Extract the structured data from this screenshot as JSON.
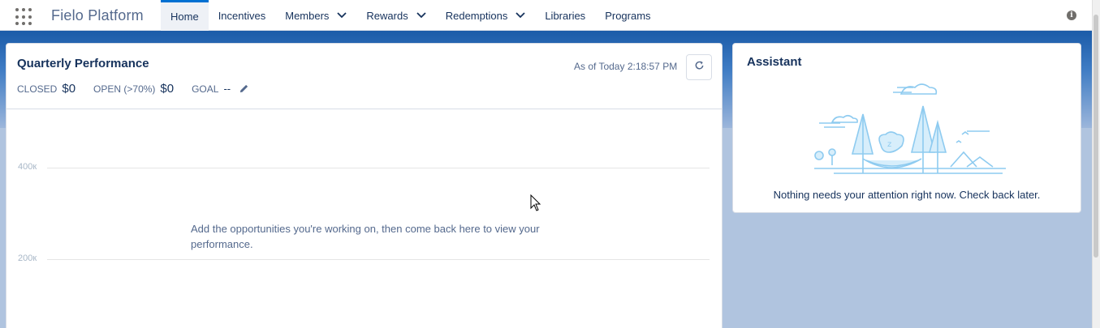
{
  "nav": {
    "app_name": "Fielo Platform",
    "items": [
      {
        "label": "Home",
        "active": true,
        "has_dropdown": false
      },
      {
        "label": "Incentives",
        "active": false,
        "has_dropdown": false
      },
      {
        "label": "Members",
        "active": false,
        "has_dropdown": true
      },
      {
        "label": "Rewards",
        "active": false,
        "has_dropdown": true
      },
      {
        "label": "Redemptions",
        "active": false,
        "has_dropdown": true
      },
      {
        "label": "Libraries",
        "active": false,
        "has_dropdown": false
      },
      {
        "label": "Programs",
        "active": false,
        "has_dropdown": false
      }
    ],
    "info_icon": "i"
  },
  "performance": {
    "title": "Quarterly Performance",
    "as_of": "As of Today 2:18:57 PM",
    "closed_label": "CLOSED",
    "closed_value": "$0",
    "open_label": "OPEN (>70%)",
    "open_value": "$0",
    "goal_label": "GOAL",
    "goal_value": "--",
    "empty_message": "Add the opportunities you're working on, then come back here to view your performance.",
    "ticks": [
      "400к",
      "200к"
    ]
  },
  "assistant": {
    "title": "Assistant",
    "message": "Nothing needs your attention right now. Check back later."
  },
  "colors": {
    "brand_blue": "#0070d2",
    "band_blue": "#1b5ba8",
    "illustration": "#8ecbf0"
  },
  "icons": [
    "app-launcher-icon",
    "chevron-down-icon",
    "info-icon",
    "refresh-icon",
    "edit-icon"
  ]
}
